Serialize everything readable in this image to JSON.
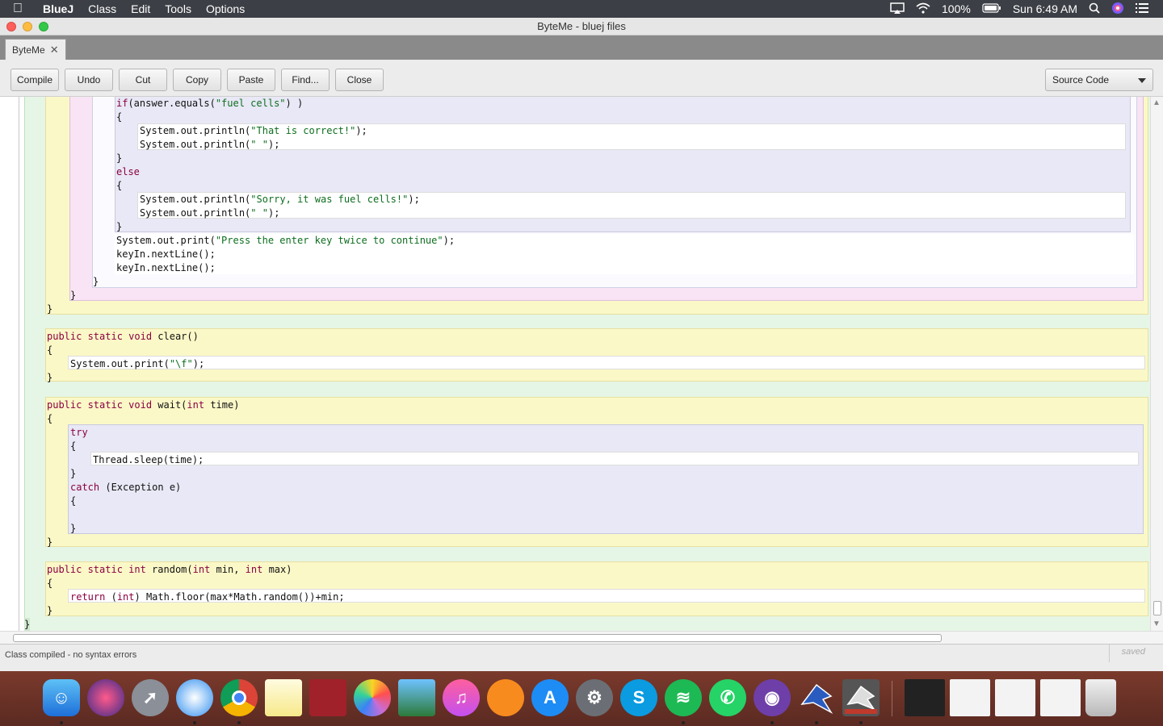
{
  "menubar": {
    "app_name": "BlueJ",
    "items": [
      "Class",
      "Edit",
      "Tools",
      "Options"
    ],
    "battery": "100%",
    "clock": "Sun 6:49 AM"
  },
  "window": {
    "title": "ByteMe - bluej files",
    "tab_label": "ByteMe"
  },
  "toolbar": {
    "compile": "Compile",
    "undo": "Undo",
    "cut": "Cut",
    "copy": "Copy",
    "paste": "Paste",
    "find": "Find...",
    "close": "Close",
    "view_select": "Source Code"
  },
  "code": {
    "l1": "if(answer.equals(\"fuel cells\") )",
    "l2": "{",
    "l3": "System.out.println(\"That is correct!\");",
    "l4": "System.out.println(\" \");",
    "l5": "}",
    "l6": "else",
    "l7": "{",
    "l8": "System.out.println(\"Sorry, it was fuel cells!\");",
    "l9": "System.out.println(\" \");",
    "l10": "}",
    "l11": "System.out.print(\"Press the enter key twice to continue\");",
    "l12": "keyIn.nextLine();",
    "l13": "keyIn.nextLine();",
    "l14": "}",
    "l15": "}",
    "l16": "}",
    "clear_sig": "public static void clear()",
    "clear_open": "{",
    "clear_body": "System.out.print(\"\\f\");",
    "clear_close": "}",
    "wait_sig": "public static void wait(int time)",
    "wait_open": "{",
    "try": "try",
    "try_open": "{",
    "sleep": "Thread.sleep(time);",
    "try_close": "}",
    "catch": "catch (Exception e)",
    "catch_open": "{",
    "catch_close": "}",
    "wait_close": "}",
    "random_sig": "public static int random(int min, int max)",
    "random_open": "{",
    "random_body": "return (int) Math.floor(max*Math.random())+min;",
    "random_close": "}",
    "class_close": "}"
  },
  "status": {
    "message": "Class compiled - no syntax errors",
    "saved": "saved"
  },
  "dock": {
    "apps": [
      "finder-icon",
      "siri-icon",
      "launchpad-icon",
      "safari-icon",
      "chrome-icon",
      "notes-icon",
      "photo-booth-icon",
      "photos-icon",
      "image-capture-icon",
      "itunes-icon",
      "ibooks-icon",
      "app-store-icon",
      "system-preferences-icon",
      "skype-icon",
      "spotify-icon",
      "whatsapp-icon",
      "github-icon",
      "bluej-icon",
      "bluej-alt-icon"
    ]
  }
}
